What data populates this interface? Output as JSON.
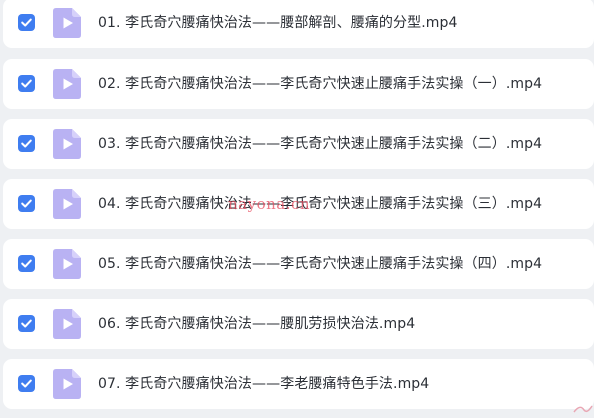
{
  "files": [
    {
      "name": "01. 李氏奇穴腰痛快治法——腰部解剖、腰痛的分型.mp4",
      "checked": true
    },
    {
      "name": "02. 李氏奇穴腰痛快治法——李氏奇穴快速止腰痛手法实操（一）.mp4",
      "checked": true
    },
    {
      "name": "03. 李氏奇穴腰痛快治法——李氏奇穴快速止腰痛手法实操（二）.mp4",
      "checked": true
    },
    {
      "name": "04. 李氏奇穴腰痛快治法——李氏奇穴快速止腰痛手法实操（三）.mp4",
      "checked": true
    },
    {
      "name": "05. 李氏奇穴腰痛快治法——李氏奇穴快速止腰痛手法实操（四）.mp4",
      "checked": true
    },
    {
      "name": "06. 李氏奇穴腰痛快治法——腰肌劳损快治法.mp4",
      "checked": true
    },
    {
      "name": "07. 李氏奇穴腰痛快治法——李老腰痛特色手法.mp4",
      "checked": true
    }
  ],
  "watermark": "nayona.cn",
  "icons": {
    "checkbox": "checkbox-checked-icon",
    "file": "video-file-icon"
  },
  "colors": {
    "checkbox": "#3f7df0",
    "file_icon": "#b9b2f3",
    "file_icon_play": "#ffffff",
    "row_bg": "#ffffff",
    "page_bg": "#eef0f3",
    "text": "#2b2f36",
    "watermark": "#e8465a"
  }
}
